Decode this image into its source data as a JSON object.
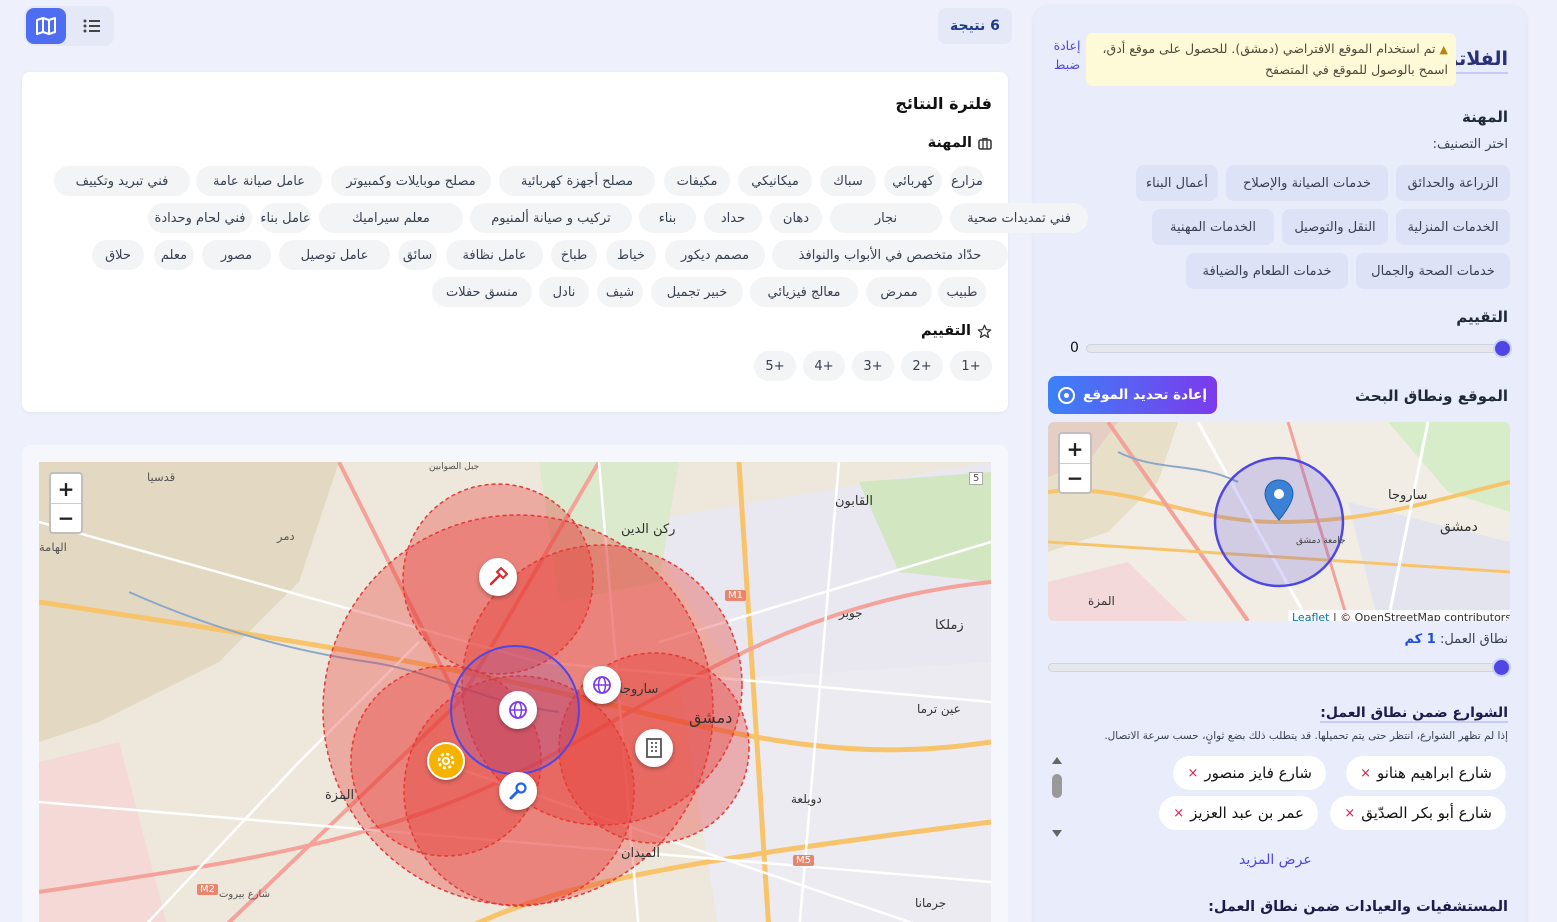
{
  "sidebar": {
    "title": "الفلاتر",
    "reset_label": "إعادة ضبط",
    "location_warning": "تم استخدام الموقع الافتراضي (دمشق). للحصول على موقع أدق، اسمح بالوصول للموقع في المتصفح",
    "profession_heading": "المهنة",
    "choose_category": "اختر التصنيف:",
    "categories": [
      "الزراعة والحدائق",
      "خدمات الصيانة والإصلاح",
      "أعمال البناء",
      "الخدمات المنزلية",
      "النقل والتوصيل",
      "الخدمات المهنية",
      "خدمات الصحة والجمال",
      "خدمات الطعام والضيافة"
    ],
    "rating_heading": "التقييم",
    "rating_value": "0",
    "location_heading": "الموقع ونطاق البحث",
    "relocate_button": "إعادة تحديد الموقع",
    "range_prefix": "نطاق العمل:",
    "range_value": "1 كم",
    "range_fraction": 1.0,
    "streets_title": "الشوارع ضمن نطاق العمل:",
    "streets_note": "إذا لم تظهر الشوارع، انتظر حتى يتم تحميلها. قد يتطلب ذلك بضع ثوانٍ، حسب سرعة الاتصال.",
    "streets": [
      "شارع ابراهيم هنانو",
      "شارع فايز منصور",
      "شارع أبو بكر الصدّيق",
      "عمر بن عبد العزيز"
    ],
    "show_more": "عرض المزيد",
    "hospitals_title": "المستشفيات والعيادات ضمن نطاق العمل:"
  },
  "results": {
    "count": "6 نتيجة"
  },
  "filter_panel": {
    "title": "فلترة النتائج",
    "profession_heading": "المهنة",
    "professions": [
      "مزارع",
      "كهربائي",
      "سباك",
      "ميكانيكي",
      "مكيفات",
      "مصلح أجهزة كهربائية",
      "مصلح موبايلات وكمبيوتر",
      "عامل صيانة عامة",
      "فني تبريد وتكييف",
      "فني تمديدات صحية",
      "نجار",
      "دهان",
      "حداد",
      "بناء",
      "تركيب و صيانة ألمنيوم",
      "معلم سيراميك",
      "عامل بناء",
      "فني لحام وحدادة",
      "حدّاد متخصص في الأبواب والنوافذ",
      "مصمم ديكور",
      "خياط",
      "طباخ",
      "عامل نظافة",
      "سائق",
      "عامل توصيل",
      "مصور",
      "معلم",
      "حلاق",
      "طبيب",
      "ممرض",
      "معالج فيزيائي",
      "خبير تجميل",
      "شيف",
      "نادل",
      "منسق حفلات"
    ],
    "rating_heading": "التقييم",
    "ratings": [
      "+1",
      "+2",
      "+3",
      "+4",
      "+5"
    ]
  },
  "mini_map": {
    "attribution_leaflet": "Leaflet",
    "attribution_osm": "| © OpenStreetMap contributors",
    "labels": [
      "دمشق",
      "ساروجا",
      "المزة",
      "جامعة دمشق"
    ]
  },
  "main_map": {
    "labels": [
      "قدسيا",
      "دمر",
      "الهامة",
      "جبل الصوابين",
      "ركن الدين",
      "القابون",
      "جوبر",
      "زملكا",
      "عين ترما",
      "دويلعة",
      "الميدان",
      "جرمانا",
      "المزة",
      "ساروجا",
      "دمشق",
      "شارع بيروت"
    ],
    "road_badges": [
      "M1",
      "M5",
      "M2",
      "5"
    ]
  },
  "map_controls": {
    "zoom_in": "+",
    "zoom_out": "−"
  },
  "colors": {
    "accent": "#4f46e5",
    "circle_red": "#e53935",
    "range_blue": "#4f46e5"
  }
}
